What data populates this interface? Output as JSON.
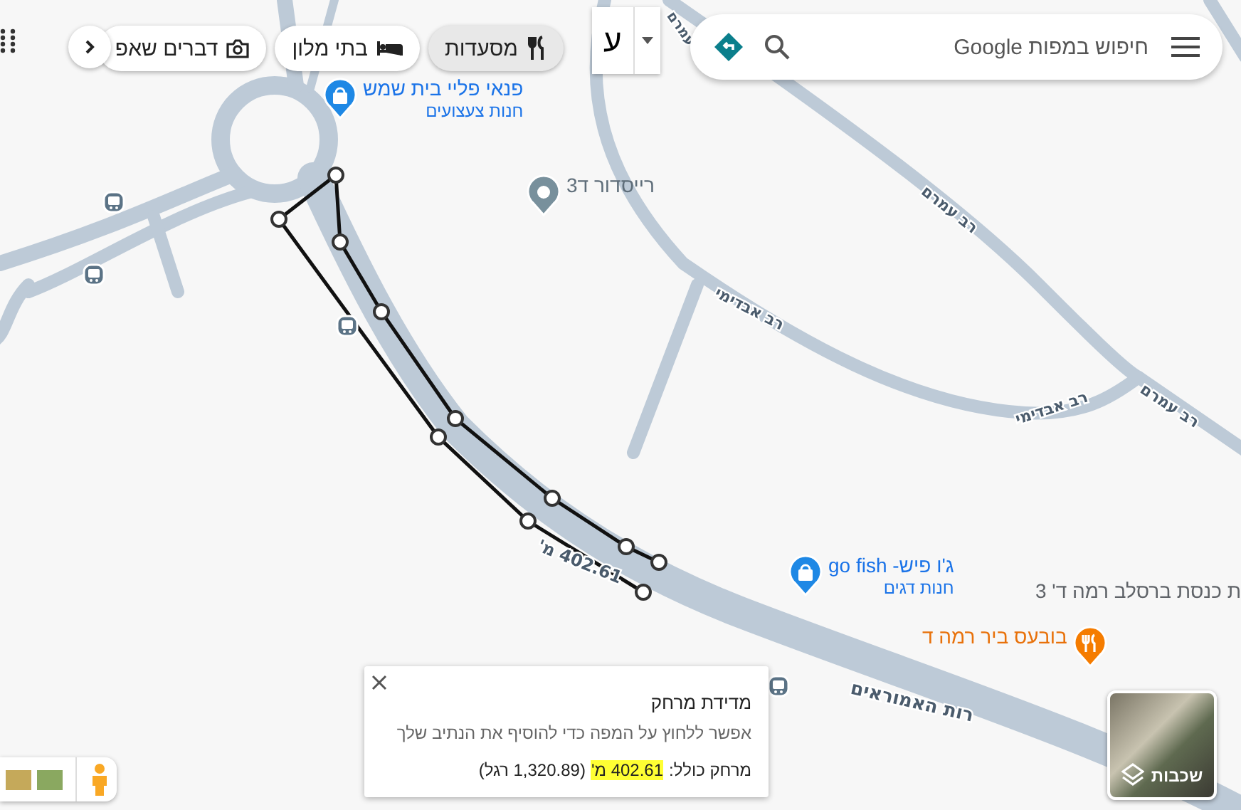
{
  "search": {
    "placeholder": "חיפוש במפות Google"
  },
  "keyboard": {
    "label": "ע"
  },
  "chips": [
    {
      "label": "מסעדות",
      "kind": "restaurants",
      "selected": true
    },
    {
      "label": "בתי מלון",
      "kind": "hotels",
      "selected": false
    },
    {
      "label": "דברים שאפ",
      "kind": "attractions",
      "selected": false
    }
  ],
  "places": [
    {
      "name": "פנאי פליי בית שמש",
      "category": "חנות צעצועים",
      "kind": "shop"
    },
    {
      "name": "רייסדור ד3",
      "kind": "place"
    },
    {
      "name": "ג'ו פיש- go fish",
      "category": "חנות דגים",
      "kind": "shop"
    },
    {
      "name": "בובעס ביר רמה ד",
      "kind": "food"
    },
    {
      "name": "ת כנסת ברסלב רמה ד' 3",
      "kind": "label"
    }
  ],
  "streets": [
    "עמרם",
    "רב עמרם",
    "רב אבדימי",
    "רב אבדימי",
    "רב עמרם",
    "רות האמוראים"
  ],
  "measure": {
    "path_label": "402.61 מ'",
    "title": "מדידת מרחק",
    "hint": "אפשר ללחוץ על המפה כדי להוסיף את הנתיב שלך",
    "total_label": "מרחק כולל:",
    "total_meters": "402.61 מ'",
    "total_feet": "(1,320.89 רגל)",
    "highlighted": true
  },
  "layers": {
    "label": "שכבות"
  }
}
